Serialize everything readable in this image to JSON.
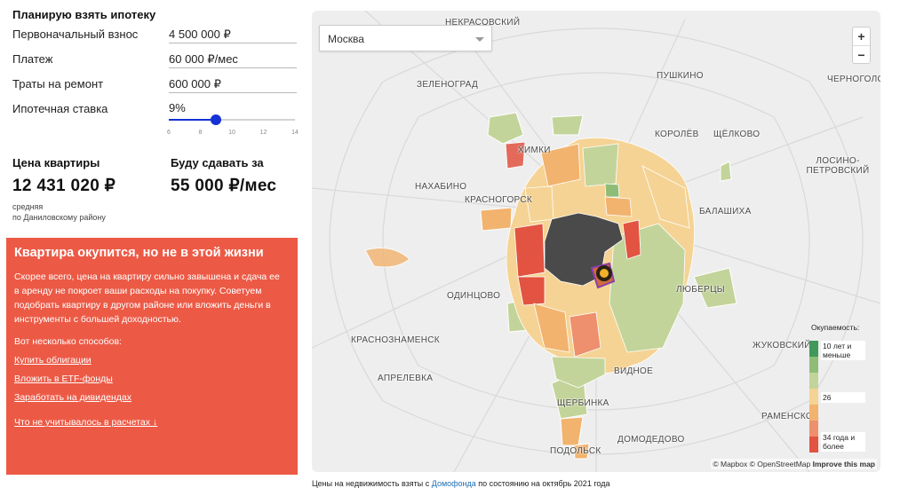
{
  "form": {
    "heading": "Планирую взять ипотеку",
    "down_payment_label": "Первоначальный взнос",
    "down_payment_value": "4 500 000 ₽",
    "payment_label": "Платеж",
    "payment_value": "60 000 ₽/мес",
    "repair_label": "Траты на ремонт",
    "repair_value": "600 000 ₽",
    "rate_label": "Ипотечная ставка",
    "rate_value": "9%",
    "rate_fraction": 0.375,
    "rate_ticks": [
      "6",
      "8",
      "10",
      "12",
      "14"
    ]
  },
  "stats": {
    "price_title": "Цена квартиры",
    "price_value": "12 431 020 ₽",
    "price_note_1": "средняя",
    "price_note_2": "по Даниловскому району",
    "rent_title": "Буду сдавать за",
    "rent_value": "55 000 ₽/мес"
  },
  "alert": {
    "title": "Квартира окупится, но не в этой жизни",
    "text": "Скорее всего, цена на квартиру сильно завышена и сдача ее в аренду не покроет ваши расходы на покупку. Советуем подобрать квартиру в другом районе или вложить деньги в инструменты с большей доходностью.",
    "ways": "Вот несколько способов:",
    "link_bonds": "Купить облигации",
    "link_etf": "Вложить в ETF-фонды",
    "link_dividends": "Заработать на дивидендах",
    "link_missed": "Что не учитывалось в расчетах ↓"
  },
  "map": {
    "city_select": "Москва",
    "zoom_in": "+",
    "zoom_out": "−",
    "cities": {
      "nekrasovsky": "Некрасовский",
      "zelenograd": "Зеленоград",
      "pushkino": "Пушкино",
      "khimki": "Химки",
      "korolev": "Королёв",
      "shchelkovo": "Щёлково",
      "nakhabino": "Нахабино",
      "krasnogorsk": "Красногорск",
      "balashikha": "Балашиха",
      "odintsovo": "Одинцово",
      "lyubertsy": "Люберцы",
      "krasnoznamensk": "Краснознаменск",
      "zhukovsky": "Жуковский",
      "aprelevka": "Апрелевка",
      "vidnoe": "Видное",
      "shcherbinka": "Щербинка",
      "ramenskoe": "Раменское",
      "domodedovo": "Домодедово",
      "podolsk": "Подольск",
      "chernogolovka": "Черноголовка",
      "losino": "Лосино-Петровский"
    },
    "legend_title": "Окупаемость:",
    "legend_top": "10 лет и меньше",
    "legend_mid": "26",
    "legend_bottom": "34 года и более",
    "legend_colors": [
      "#3f9a5a",
      "#8fbd78",
      "#c3d49a",
      "#f5d394",
      "#f2b36e",
      "#ee8f6d",
      "#e25341"
    ],
    "attribution": "© Mapbox © OpenStreetMap",
    "improve": "Improve this map"
  },
  "caption": {
    "before": "Цены на недвижимость взяты с ",
    "link": "Домофонда",
    "after": " по состоянию на октябрь 2021 года"
  }
}
